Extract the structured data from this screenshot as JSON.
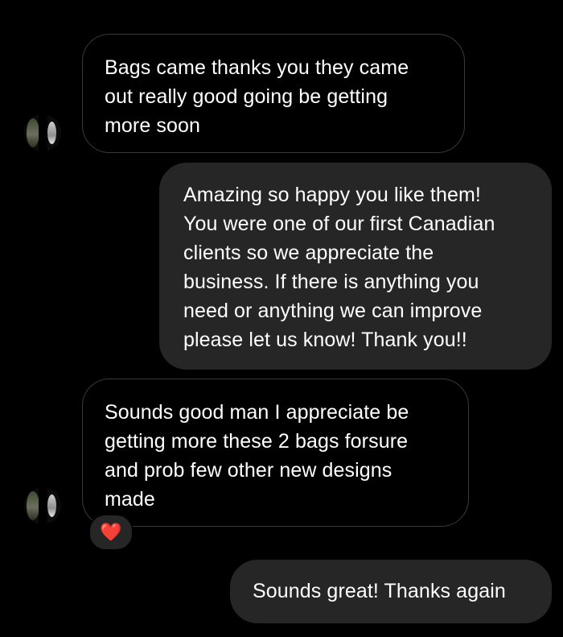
{
  "conversation": {
    "messages": [
      {
        "direction": "incoming",
        "text": "Bags came thanks you they came\nout really good going be getting\nmore soon"
      },
      {
        "direction": "outgoing",
        "text": "Amazing so happy you like them!\nYou were one of our first Canadian\nclients so we appreciate the\nbusiness. If there is anything you\nneed or anything we can improve\nplease let us know! Thank you!!"
      },
      {
        "direction": "incoming",
        "text": "Sounds good man I appreciate be\ngetting more these 2 bags forsure\nand prob few other new designs\nmade",
        "reaction": "❤️"
      },
      {
        "direction": "outgoing",
        "text": "Sounds great! Thanks again"
      }
    ]
  },
  "icons": {
    "avatar": "contact-avatar-icon",
    "reaction": "heart-reaction-icon"
  },
  "colors": {
    "background": "#000000",
    "outgoing_bubble": "#262626",
    "incoming_border": "#3a3a3c",
    "text": "#ffffff",
    "heart": "#ff2d3a"
  }
}
